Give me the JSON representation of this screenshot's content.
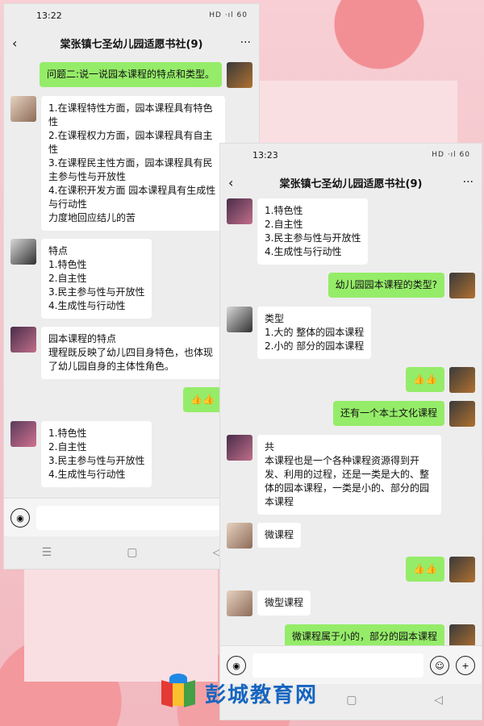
{
  "left_phone": {
    "status_time": "13:22",
    "status_icons": "HD ·ıl 60",
    "title": "棠张镇七圣幼儿园适愿书社(9)",
    "messages": [
      {
        "side": "right",
        "avatar": "av1",
        "text": "问题二:说一说园本课程的特点和类型。"
      },
      {
        "side": "left",
        "avatar": "av2",
        "text": "1.在课程特性方面，园本课程具有特色性\n2.在课程权力方面，园本课程具有自主性\n3.在课程民主性方面，园本课程具有民主参与性与开放性\n4.在课积开发方面 园本课程具有生成性与行动性\n力度地回应结儿的苦"
      },
      {
        "side": "left",
        "avatar": "av3",
        "text": "特点\n1.特色性\n2.自主性\n3.民主参与性与开放性\n4.生成性与行动性"
      },
      {
        "side": "left",
        "avatar": "av4",
        "text": "园本课程的特点\n理程既反映了幼儿四目身特色，也体现了幼儿园自身的主体性角色。"
      },
      {
        "side": "right",
        "avatar": "av1",
        "text": "👍👍"
      },
      {
        "side": "left",
        "avatar": "av5",
        "text": "1.特色性\n2.自主性\n3.民主参与性与开放性\n4.生成性与行动性"
      }
    ],
    "nav_keys": [
      "☰",
      "▢",
      "◁"
    ]
  },
  "right_phone": {
    "status_time": "13:23",
    "status_icons": "HD ·ıl 60",
    "title": "棠张镇七圣幼儿园适愿书社(9)",
    "messages": [
      {
        "side": "left",
        "avatar": "av4",
        "text": "1.特色性\n2.自主性\n3.民主参与性与开放性\n4.生成性与行动性"
      },
      {
        "side": "right",
        "avatar": "av1",
        "text": "幼儿园园本课程的类型?"
      },
      {
        "side": "left",
        "avatar": "av3",
        "text": "类型\n1.大的 整体的园本课程\n2.小的 部分的园本课程"
      },
      {
        "side": "right",
        "avatar": "av1",
        "text": "👍👍"
      },
      {
        "side": "right",
        "avatar": "av1",
        "text": "还有一个本土文化课程"
      },
      {
        "side": "left",
        "avatar": "av4",
        "text": "共\n本课程也是一个各种课程资源得到开发、利用的过程，还是一类是大的、整体的园本课程，一类是小的、部分的园本课程"
      },
      {
        "side": "left",
        "avatar": "av2",
        "text": "微课程"
      },
      {
        "side": "right",
        "avatar": "av1",
        "text": "👍👍"
      },
      {
        "side": "left",
        "avatar": "av2",
        "text": "微型课程"
      },
      {
        "side": "right",
        "avatar": "av1",
        "text": "微课程属于小的，部分的园本课程"
      }
    ],
    "nav_keys": [
      "☰",
      "▢",
      "◁"
    ]
  },
  "watermark": {
    "text": "彭城教育网"
  }
}
